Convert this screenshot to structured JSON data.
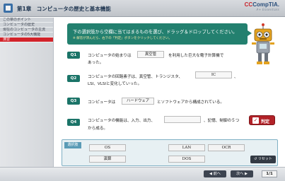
{
  "header": {
    "title": "第1章　コンピュータの歴史と基本機能",
    "logo_main_cc": "CC",
    "logo_main_text": "CompTIA.",
    "logo_sub": "A+ Essentials"
  },
  "sidebar": {
    "items": [
      {
        "label": "この章のポイント",
        "active": false
      },
      {
        "label": "コンピュータの歴史",
        "active": false
      },
      {
        "label": "現在のコンピュータの主流",
        "active": false
      },
      {
        "label": "コンピュータの5大機能",
        "active": false
      },
      {
        "label": "演習",
        "active": true
      }
    ]
  },
  "instruction": {
    "line1": "下の選択肢から空欄に当てはまるものを選び、ドラッグ＆ドロップしてください。",
    "line2": "※ 解答が済んだら、右下の「判定」ボタンをクリックしてください。"
  },
  "questions": [
    {
      "number": "Q1",
      "part1": "コンピュータの始まりは",
      "blank": "真空管",
      "part2": "を利用した巨大な電子計算機で",
      "line2": "あった。"
    },
    {
      "number": "Q2",
      "part1": "コンピュータの回路素子は、真空管、トランジスタ、",
      "blank": "IC",
      "part2": "、",
      "line2": "LSI、VLSIと変化していった。"
    },
    {
      "number": "Q3",
      "part1": "コンピュータは",
      "blank": "ハードウェア",
      "part2": "とソフトウェアから構成されている。",
      "line2": ""
    },
    {
      "number": "Q4",
      "part1": "コンピュータの機能は、入力、出力、",
      "blank": "",
      "part2": "、記憶、制御の５つ",
      "line2": "から成る。"
    }
  ],
  "judge_button": {
    "label": "判定",
    "icon": "check-icon"
  },
  "choices": {
    "label": "選択肢",
    "items": [
      "OS",
      "LAN",
      "OCR",
      "演算",
      "DOS"
    ],
    "reset_label": "リセット"
  },
  "footer": {
    "prev_label": "◀ 前へ",
    "next_label": "次へ ▶",
    "page_counter": "1/1"
  },
  "colors": {
    "accent_teal": "#1b7468",
    "bubble_green": "#23806f",
    "active_red": "#d2232a",
    "judge_red": "#b22228"
  }
}
